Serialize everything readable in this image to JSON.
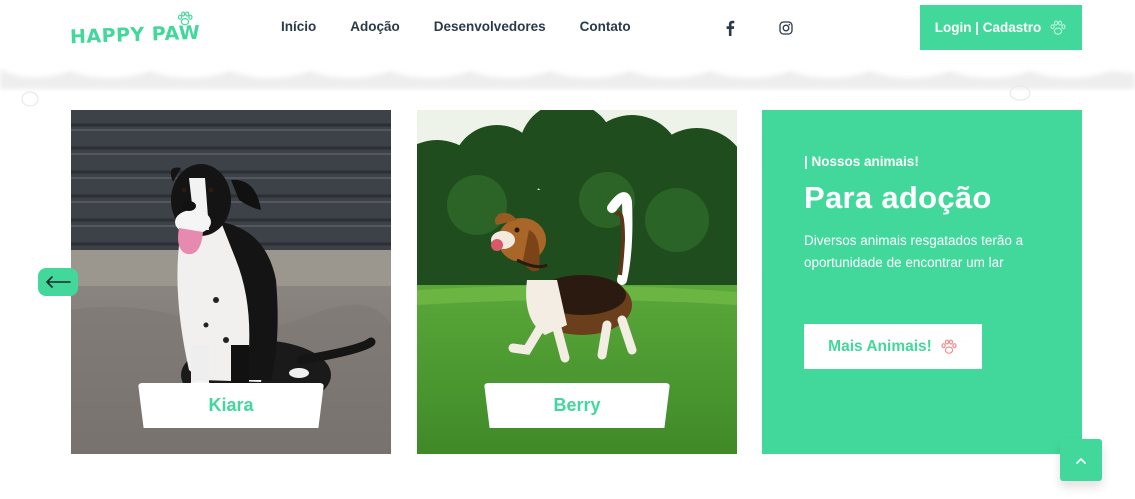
{
  "brand": {
    "logo_text": "HAPPY PAW",
    "accent": "#43d89b",
    "text_dark": "#2b3a4a"
  },
  "nav": {
    "items": [
      {
        "label": "Início"
      },
      {
        "label": "Adoção"
      },
      {
        "label": "Desenvolvedores"
      },
      {
        "label": "Contato"
      }
    ]
  },
  "social": {
    "facebook_icon": "facebook-icon",
    "instagram_icon": "instagram-icon"
  },
  "login": {
    "label": "Login | Cadastro",
    "icon": "paw-outline-icon"
  },
  "carousel": {
    "prev_icon": "arrow-left-icon",
    "cards": [
      {
        "name": "Kiara",
        "photo": "black-white-dog-photo"
      },
      {
        "name": "Berry",
        "photo": "beagle-photo"
      }
    ]
  },
  "info": {
    "eyebrow": "| Nossos animais!",
    "headline": "Para adoção",
    "description": "Diversos animais resgatados terão a oportunidade de encontrar um lar",
    "button_label": "Mais Animais!",
    "button_icon": "paw-outline-icon"
  },
  "scroll_top": {
    "icon": "chevron-up-icon"
  }
}
